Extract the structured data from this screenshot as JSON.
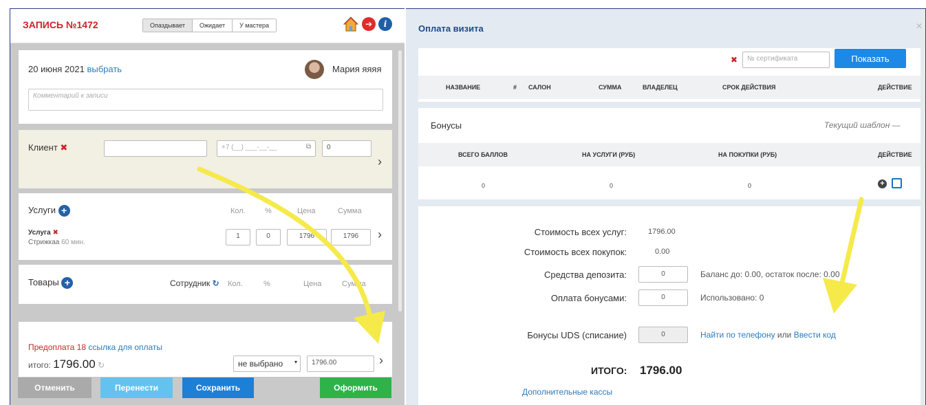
{
  "left": {
    "title": "ЗАПИСЬ №1472",
    "statuses": [
      "Опаздывает",
      "Ожидает",
      "У мастера"
    ],
    "date": "20 июня 2021",
    "date_link": "выбрать",
    "master": "Мария яяяя",
    "comment_placeholder": "Комментарий к записи",
    "client_label": "Клиент",
    "client_name_value": "",
    "phone_placeholder": "+7 (__) ___-__-__",
    "client_number": "0",
    "services_label": "Услуги",
    "col_qty": "Кол.",
    "col_percent": "%",
    "col_price": "Цена",
    "col_sum": "Сумма",
    "service_name": "Услуга",
    "service_detail": "Стрижкаа",
    "service_duration": "60 мин.",
    "service_qty": "1",
    "service_percent": "0",
    "service_price": "1796",
    "service_sum": "1796",
    "goods_label": "Товары",
    "employee_label": "Сотрудник",
    "prepay_label": "Предоплата 18",
    "prepay_link": "ссылка для оплаты",
    "total_label": "итого:",
    "total_value": "1796.00",
    "payment_select": "не выбрано",
    "payment_amount": "1796.00",
    "buttons": {
      "cancel": "Отменить",
      "move": "Перенести",
      "save": "Сохранить",
      "checkout": "Оформить"
    }
  },
  "right": {
    "title": "Оплата визита",
    "cert_placeholder": "№ сертификата",
    "show_button": "Показать",
    "cert_headers": [
      "НАЗВАНИЕ",
      "#",
      "САЛОН",
      "СУММА",
      "ВЛАДЕЛЕЦ",
      "СРОК ДЕЙСТВИЯ",
      "ДЕЙСТВИЕ"
    ],
    "bonus_title": "Бонусы",
    "template_label": "Текущий шаблон",
    "bonus_headers": [
      "ВСЕГО БАЛЛОВ",
      "НА УСЛУГИ (РУБ)",
      "НА ПОКУПКИ (РУБ)",
      "ДЕЙСТВИЕ"
    ],
    "bonus_values": [
      "0",
      "0",
      "0"
    ],
    "services_cost_label": "Стоимость всех услуг:",
    "services_cost": "1796.00",
    "goods_cost_label": "Стоимость всех покупок:",
    "goods_cost": "0.00",
    "deposit_label": "Средства депозита:",
    "deposit_value": "0",
    "deposit_note": "Баланс до: 0.00, остаток после: 0.00",
    "bonus_pay_label": "Оплата бонусами:",
    "bonus_pay_value": "0",
    "bonus_used": "Использовано: 0",
    "uds_label": "Бонусы UDS (списание)",
    "uds_value": "0",
    "uds_find": "Найти по телефону",
    "uds_or": "или",
    "uds_code": "Ввести код",
    "total_label": "ИТОГО:",
    "total_value": "1796.00",
    "extra_cash": "Дополнительные кассы"
  },
  "colors": {
    "accent_red": "#d0202a",
    "link_blue": "#2b7bc0",
    "primary_blue": "#1e88e5",
    "green": "#2db34a",
    "arrow_yellow": "#f5ea4a"
  }
}
